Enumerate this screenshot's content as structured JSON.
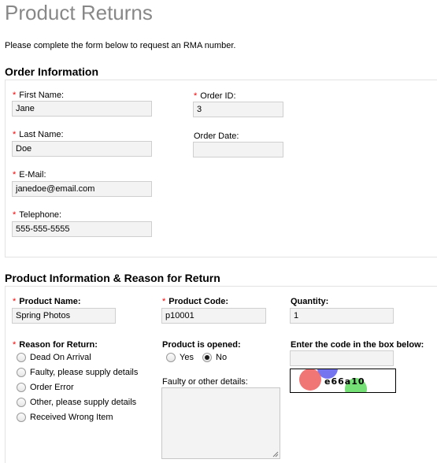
{
  "page": {
    "title": "Product Returns",
    "intro": "Please complete the form below to request an RMA number."
  },
  "order_section": {
    "heading": "Order Information",
    "required_marker": "*",
    "first_name": {
      "label": "First Name:",
      "value": "Jane",
      "required": true
    },
    "last_name": {
      "label": "Last Name:",
      "value": "Doe",
      "required": true
    },
    "email": {
      "label": "E-Mail:",
      "value": "janedoe@email.com",
      "required": true
    },
    "telephone": {
      "label": "Telephone:",
      "value": "555-555-5555",
      "required": true
    },
    "order_id": {
      "label": "Order ID:",
      "value": "3",
      "required": true
    },
    "order_date": {
      "label": "Order Date:",
      "value": "",
      "required": false
    }
  },
  "product_section": {
    "heading": "Product Information & Reason for Return",
    "product_name": {
      "label": "Product Name:",
      "value": "Spring Photos",
      "required": true
    },
    "product_code": {
      "label": "Product Code:",
      "value": "p10001",
      "required": true
    },
    "quantity": {
      "label": "Quantity:",
      "value": "1",
      "required": false
    },
    "reason": {
      "label": "Reason for Return:",
      "options": [
        "Dead On Arrival",
        "Faulty, please supply details",
        "Order Error",
        "Other, please supply details",
        "Received Wrong Item"
      ],
      "selected": null
    },
    "opened": {
      "label": "Product is opened:",
      "yes_label": "Yes",
      "no_label": "No",
      "selected": "No"
    },
    "details": {
      "label": "Faulty or other details:",
      "value": ""
    },
    "captcha": {
      "label": "Enter the code in the box below:",
      "value": "",
      "code_text": "e66a10"
    }
  }
}
